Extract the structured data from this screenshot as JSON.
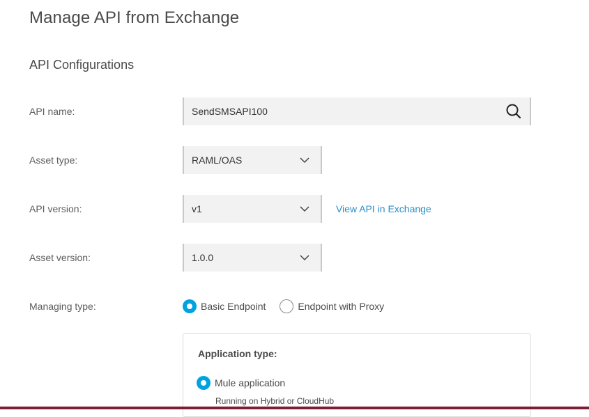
{
  "page": {
    "title": "Manage API from Exchange",
    "section_title": "API Configurations"
  },
  "form": {
    "api_name": {
      "label": "API name:",
      "value": "SendSMSAPI100",
      "icon": "search-icon"
    },
    "asset_type": {
      "label": "Asset type:",
      "value": "RAML/OAS",
      "icon": "chevron-down-icon"
    },
    "api_version": {
      "label": "API version:",
      "value": "v1",
      "icon": "chevron-down-icon",
      "link_label": "View API in Exchange"
    },
    "asset_version": {
      "label": "Asset version:",
      "value": "1.0.0",
      "icon": "chevron-down-icon"
    },
    "managing_type": {
      "label": "Managing type:",
      "options": [
        {
          "label": "Basic Endpoint",
          "selected": true
        },
        {
          "label": "Endpoint with Proxy",
          "selected": false
        }
      ]
    }
  },
  "application_type": {
    "title": "Application type:",
    "option_label": "Mule application",
    "option_selected": true,
    "option_subtext": "Running on Hybrid or CloudHub"
  },
  "colors": {
    "accent": "#00a2df",
    "link": "#2a8ec9",
    "field_bg": "#f2f2f2",
    "bottom_bar": "#7a1f35"
  }
}
